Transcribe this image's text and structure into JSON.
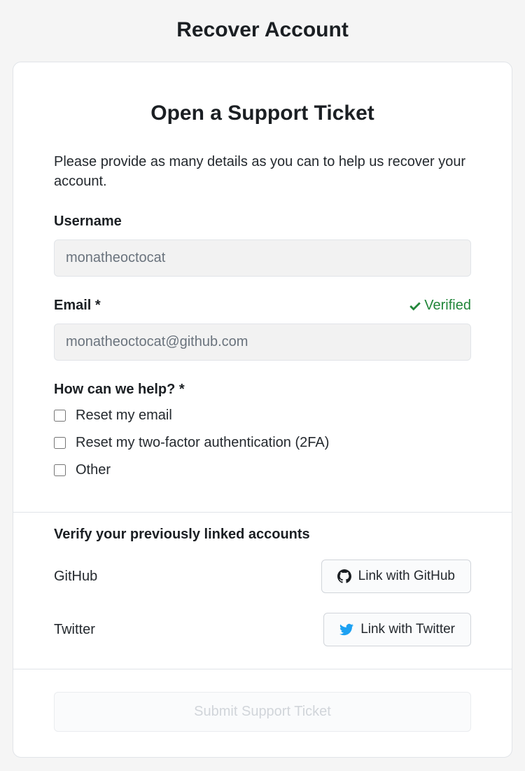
{
  "page_title": "Recover Account",
  "card": {
    "title": "Open a Support Ticket",
    "intro": "Please provide as many details as you can to help us recover your account."
  },
  "fields": {
    "username": {
      "label": "Username",
      "value": "monatheoctocat"
    },
    "email": {
      "label": "Email *",
      "value": "monatheoctocat@github.com",
      "verified_text": "Verified"
    }
  },
  "help": {
    "label": "How can we help? *",
    "options": [
      "Reset my email",
      "Reset my two-factor authentication (2FA)",
      "Other"
    ]
  },
  "linked": {
    "title": "Verify your previously linked accounts",
    "providers": {
      "github": {
        "label": "GitHub",
        "button": "Link with GitHub"
      },
      "twitter": {
        "label": "Twitter",
        "button": "Link with Twitter"
      }
    }
  },
  "submit": {
    "label": "Submit Support Ticket"
  }
}
